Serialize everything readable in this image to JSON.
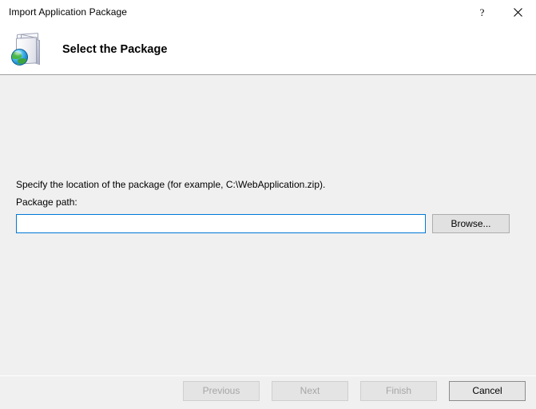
{
  "window": {
    "title": "Import Application Package",
    "help_button": "?",
    "close_button": "✕",
    "help_icon_name": "help-icon",
    "close_icon_name": "close-icon"
  },
  "header": {
    "title": "Select the Package",
    "icon_name": "package-globe-icon"
  },
  "main": {
    "intro_text": "Specify the location of the package (for example, C:\\WebApplication.zip).",
    "field_label": "Package path:",
    "path_value": "",
    "path_placeholder": "",
    "browse_label": "Browse..."
  },
  "footer": {
    "buttons": [
      {
        "label": "Previous",
        "enabled": false,
        "name": "previous-button"
      },
      {
        "label": "Next",
        "enabled": false,
        "name": "next-button"
      },
      {
        "label": "Finish",
        "enabled": false,
        "name": "finish-button"
      },
      {
        "label": "Cancel",
        "enabled": true,
        "name": "cancel-button"
      }
    ]
  },
  "colors": {
    "window_bg": "#f0f0f0",
    "header_bg": "#ffffff",
    "accent_focus": "#0078d7",
    "button_bg": "#e1e1e1",
    "button_border": "#adadad",
    "disabled_text": "#a6a6a6",
    "separator": "#a0a0a0"
  }
}
